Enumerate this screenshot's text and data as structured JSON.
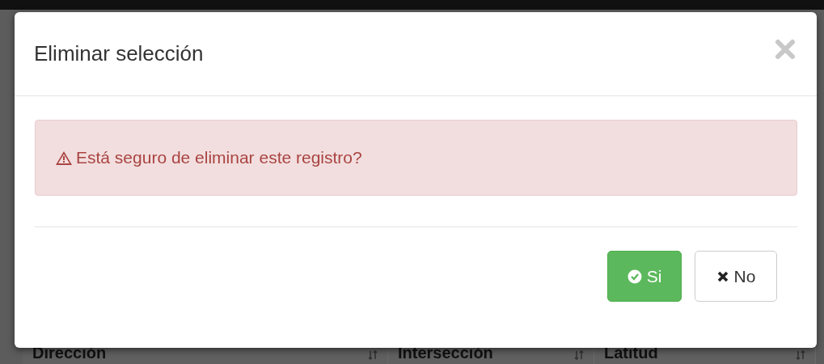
{
  "background_table": {
    "columns": [
      "Dirección",
      "Intersección",
      "Latitud"
    ]
  },
  "modal": {
    "title": "Eliminar selección",
    "alert": {
      "kind": "danger",
      "message": "Está seguro de eliminar este registro?"
    },
    "buttons": [
      {
        "label": "Si",
        "kind": "confirm"
      },
      {
        "label": "No",
        "kind": "cancel"
      }
    ]
  }
}
